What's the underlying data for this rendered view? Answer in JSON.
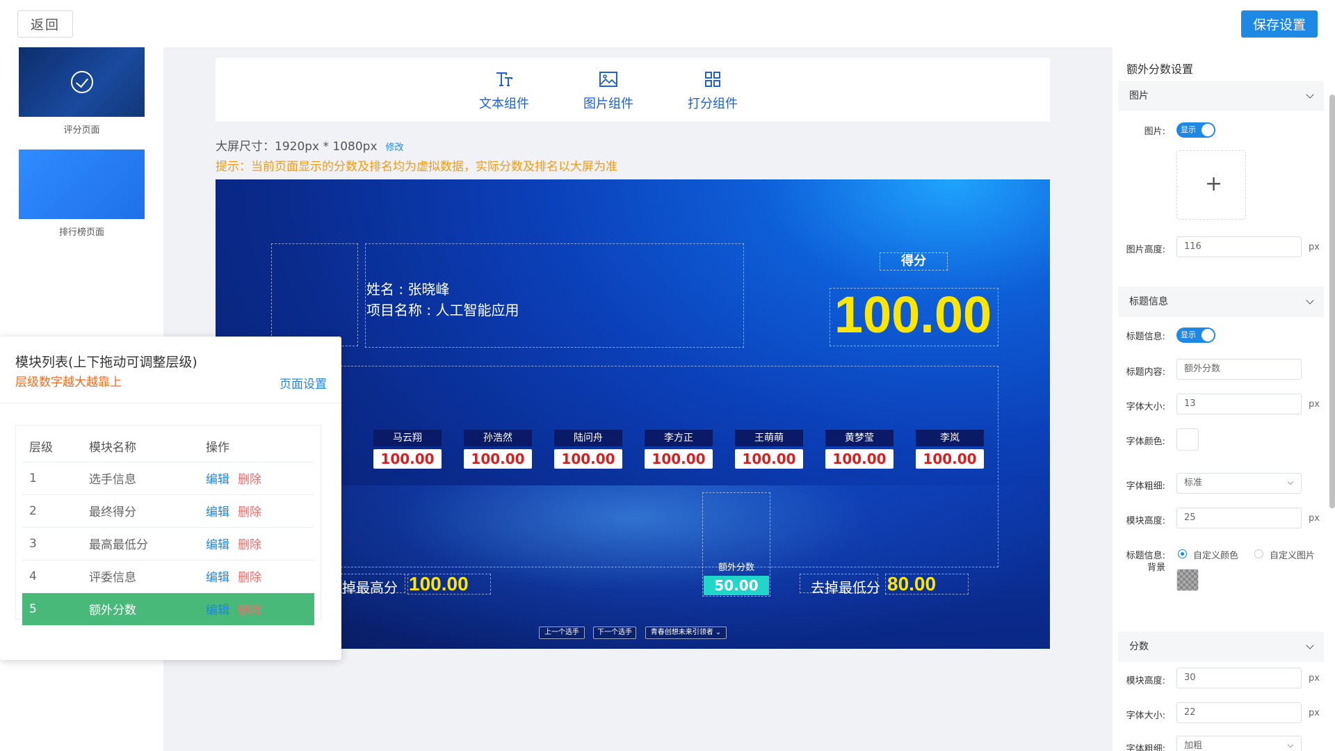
{
  "topbar": {
    "back_label": "返回",
    "save_label": "保存设置"
  },
  "pages": [
    {
      "label": "评分页面"
    },
    {
      "label": "排行榜页面"
    }
  ],
  "toolbar": {
    "items": [
      {
        "label": "文本组件",
        "icon": "text-icon"
      },
      {
        "label": "图片组件",
        "icon": "image-icon"
      },
      {
        "label": "打分组件",
        "icon": "grid-icon"
      }
    ]
  },
  "canvas": {
    "size_label": "大屏尺寸：",
    "size_value": "1920px * 1080px",
    "edit_label": "修改",
    "tip": "提示：当前页面显示的分数及排名均为虚拟数据，实际分数及排名以大屏为准"
  },
  "screen": {
    "name_line": "姓名 : 张晓峰",
    "project_line": "项目名称 : 人工智能应用",
    "score_title": "得分",
    "score_value": "100.00",
    "judges": [
      {
        "name": "马云翔",
        "score": "100.00"
      },
      {
        "name": "孙浩然",
        "score": "100.00"
      },
      {
        "name": "陆问舟",
        "score": "100.00"
      },
      {
        "name": "李方正",
        "score": "100.00"
      },
      {
        "name": "王萌萌",
        "score": "100.00"
      },
      {
        "name": "黄梦莹",
        "score": "100.00"
      },
      {
        "name": "李岚",
        "score": "100.00"
      }
    ],
    "extra_label": "额外分数",
    "extra_value": "50.00",
    "remove_high_label": "去掉最高分",
    "remove_high_value": "100.00",
    "remove_low_label": "去掉最低分",
    "remove_low_value": "80.00",
    "nav": {
      "prev": "上一个选手",
      "next": "下一个选手",
      "select": "青春创想未来引领者"
    }
  },
  "module_panel": {
    "title": "模块列表(上下拖动可调整层级)",
    "subtitle": "层级数字越大越靠上",
    "page_settings": "页面设置",
    "headers": {
      "level": "层级",
      "name": "模块名称",
      "ops": "操作"
    },
    "edit_label": "编辑",
    "delete_label": "删除",
    "rows": [
      {
        "level": "1",
        "name": "选手信息"
      },
      {
        "level": "2",
        "name": "最终得分"
      },
      {
        "level": "3",
        "name": "最高最低分"
      },
      {
        "level": "4",
        "name": "评委信息"
      },
      {
        "level": "5",
        "name": "额外分数"
      }
    ]
  },
  "settings": {
    "title": "额外分数设置",
    "image_section": "图片",
    "image_label": "图片:",
    "image_switch": "显示",
    "image_height_label": "图片高度:",
    "image_height": "116",
    "title_section": "标题信息",
    "title_info_label": "标题信息:",
    "title_info_switch": "显示",
    "title_content_label": "标题内容:",
    "title_content": "额外分数",
    "font_size_label": "字体大小:",
    "font_size": "13",
    "font_color_label": "字体颜色:",
    "font_weight_label": "字体粗细:",
    "font_weight": "标准",
    "module_height_label": "模块高度:",
    "module_height": "25",
    "bg_label_1": "标题信息:",
    "bg_label_2": "背景",
    "bg_option_color": "自定义颜色",
    "bg_option_image": "自定义图片",
    "score_section": "分数",
    "score_module_height_label": "模块高度:",
    "score_module_height": "30",
    "score_font_size_label": "字体大小:",
    "score_font_size": "22",
    "score_font_weight_label": "字体粗细:",
    "score_font_weight": "加粗",
    "unit": "px"
  },
  "colors": {
    "primary": "#1e88e5",
    "active_row": "#48b978",
    "tip": "#f39c12",
    "score_yellow": "#ffe600",
    "extra_teal": "#1fd6c8"
  }
}
